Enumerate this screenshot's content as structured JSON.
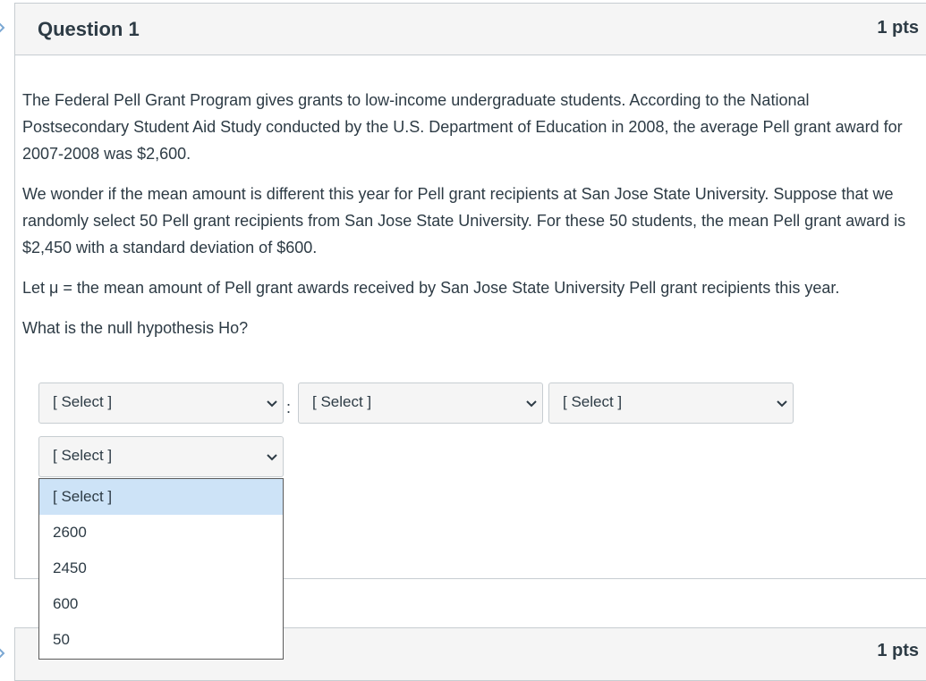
{
  "question": {
    "title": "Question 1",
    "points": "1 pts",
    "paragraphs": [
      "The Federal Pell Grant Program gives grants to low-income undergraduate students. According to the National Postsecondary Student Aid Study conducted by the U.S. Department of Education in 2008, the average Pell grant award for 2007-2008 was $2,600.",
      "We wonder if the mean amount is different this year for Pell grant recipients at San Jose State University. Suppose that we randomly select 50 Pell grant recipients from San Jose State University. For these 50 students, the mean Pell grant award is $2,450 with a standard deviation of $600.",
      "Let μ = the mean amount of Pell grant awards received by San Jose State University Pell grant recipients this year.",
      "What is the null hypothesis Ho?"
    ],
    "selects": [
      {
        "value": "[ Select ]"
      },
      {
        "value": "[ Select ]"
      },
      {
        "value": "[ Select ]"
      },
      {
        "value": "[ Select ]"
      }
    ],
    "colon": ":",
    "dropdown_options": [
      "[ Select ]",
      "2600",
      "2450",
      "600",
      "50"
    ]
  },
  "next_question": {
    "points": "1 pts"
  },
  "icons": {
    "edge": "chevron-right-icon",
    "select": "chevron-down-icon"
  }
}
